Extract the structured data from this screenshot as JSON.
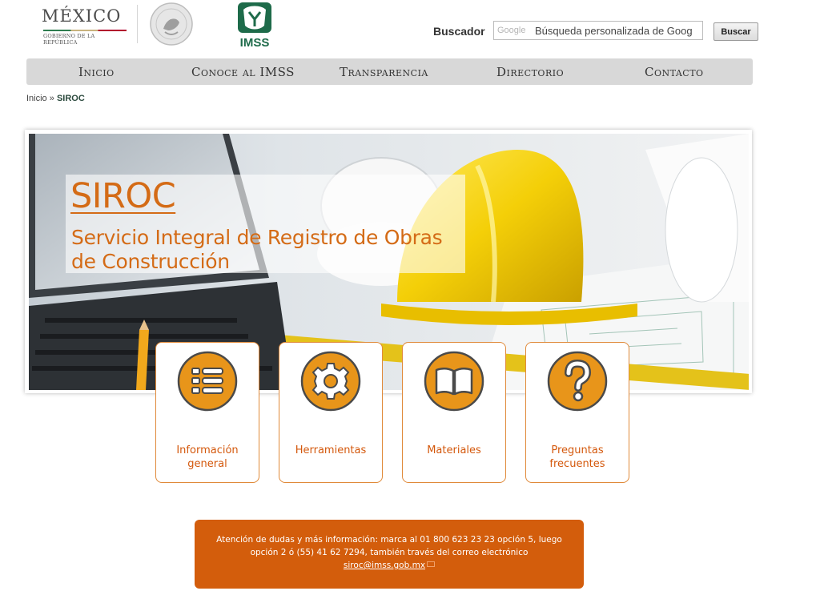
{
  "header": {
    "gov_logo": {
      "word": "MÉXICO",
      "subtitle": "GOBIERNO DE LA REPÚBLICA"
    },
    "imss_logo_text": "IMSS",
    "search": {
      "label": "Buscador",
      "provider": "Google",
      "placeholder": "Búsqueda personalizada de Goog",
      "button": "Buscar"
    }
  },
  "nav": {
    "items": [
      {
        "label": "Inicio"
      },
      {
        "label": "Conoce al IMSS"
      },
      {
        "label": "Transparencia"
      },
      {
        "label": "Directorio"
      },
      {
        "label": "Contacto"
      }
    ]
  },
  "breadcrumb": {
    "home": "Inicio",
    "separator": "»",
    "current": "SIROC"
  },
  "banner": {
    "title": "SIROC",
    "subtitle": "Servicio Integral de Registro de Obras de Construcción"
  },
  "cards": [
    {
      "label": "Información general",
      "icon": "list-icon"
    },
    {
      "label": "Herramientas",
      "icon": "gear-icon"
    },
    {
      "label": "Materiales",
      "icon": "book-icon"
    },
    {
      "label": "Preguntas frecuentes",
      "icon": "question-icon"
    }
  ],
  "info": {
    "text": "Atención de dudas y más información: marca al 01 800 623 23 23 opción 5, luego opción 2 ó (55) 41 62 7294, también través del correo electrónico",
    "email": "siroc@imss.gob.mx"
  },
  "colors": {
    "accent": "#d46b16",
    "icon_fill": "#e8951a",
    "info_bg": "#d35d0c",
    "imss_green": "#1e6b4a"
  }
}
